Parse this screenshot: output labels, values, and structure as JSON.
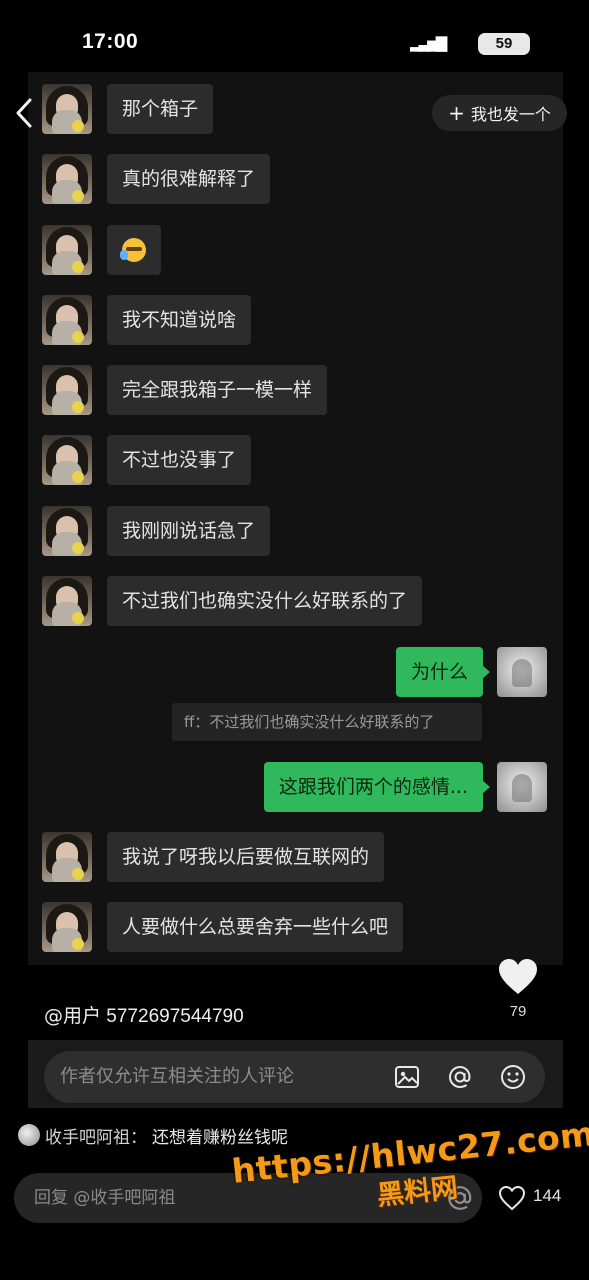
{
  "status_bar": {
    "time": "17:00",
    "signal": "▂▃▅▇",
    "battery": "59"
  },
  "header": {
    "back_icon": "chevron-left-icon",
    "add_button": {
      "icon": "+",
      "label": "我也发一个"
    }
  },
  "chat": {
    "messages": [
      {
        "side": "in",
        "text": "那个箱子"
      },
      {
        "side": "in",
        "text": "真的很难解释了"
      },
      {
        "side": "in",
        "text": "",
        "emoji": "crying-laughing-emoji"
      },
      {
        "side": "in",
        "text": "我不知道说啥"
      },
      {
        "side": "in",
        "text": "完全跟我箱子一模一样"
      },
      {
        "side": "in",
        "text": "不过也没事了"
      },
      {
        "side": "in",
        "text": "我刚刚说话急了"
      },
      {
        "side": "in",
        "text": "不过我们也确实没什么好联系的了"
      },
      {
        "side": "out",
        "text": "为什么"
      },
      {
        "side": "out",
        "text": "这跟我们两个的感情..."
      },
      {
        "side": "in",
        "text": "我说了呀我以后要做互联网的"
      },
      {
        "side": "in",
        "text": "人要做什么总要舍弃一些什么吧"
      }
    ],
    "quote": "ff：不过我们也确实没什么好联系的了"
  },
  "post": {
    "author_at": "@",
    "author_label": "用户",
    "author_id": "5772697544790",
    "like_count": "79"
  },
  "comment_input": {
    "placeholder": "作者仅允许互相关注的人评论",
    "icons": [
      "image-icon",
      "at-icon",
      "emoji-icon"
    ]
  },
  "top_comment": {
    "user": "收手吧阿祖：",
    "text": "还想着赚粉丝钱呢"
  },
  "reply_input": {
    "placeholder": "回复 @收手吧阿祖",
    "like_count": "144"
  },
  "watermark": {
    "url": "https://hlwc27.com",
    "name": "黑料网"
  },
  "colors": {
    "background": "#000000",
    "chat_background": "#121212",
    "incoming_bubble": "#2c2c2c",
    "outgoing_bubble": "#2fb95c",
    "watermark": "#f59a16"
  }
}
